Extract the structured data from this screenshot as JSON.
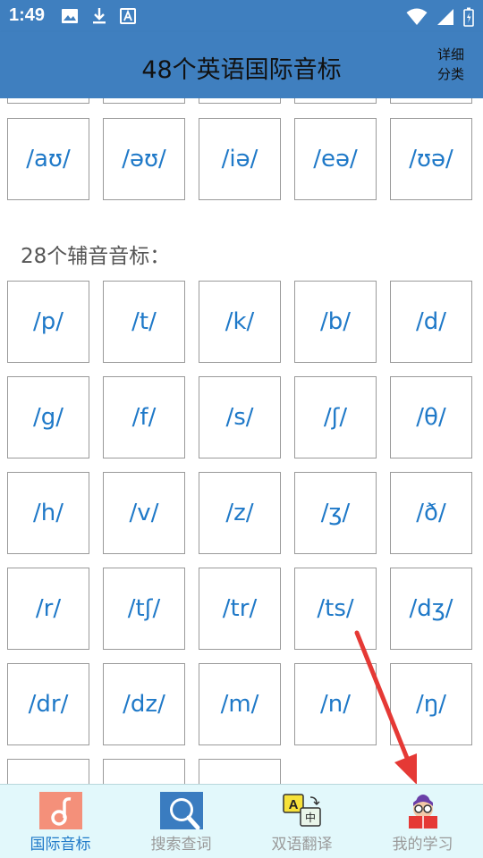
{
  "status_bar": {
    "time": "1:49"
  },
  "app_bar": {
    "title": "48个英语国际音标",
    "detail_line1": "详细",
    "detail_line2": "分类"
  },
  "vowels_tail": [
    "/aʊ/",
    "/əʊ/",
    "/iə/",
    "/eə/",
    "/ʊə/"
  ],
  "consonants": {
    "heading": "28个辅音音标：",
    "rows": [
      [
        "/p/",
        "/t/",
        "/k/",
        "/b/",
        "/d/"
      ],
      [
        "/g/",
        "/f/",
        "/s/",
        "/ʃ/",
        "/θ/"
      ],
      [
        "/h/",
        "/v/",
        "/z/",
        "/ʒ/",
        "/ð/"
      ],
      [
        "/r/",
        "/tʃ/",
        "/tr/",
        "/ts/",
        "/dʒ/"
      ],
      [
        "/dr/",
        "/dz/",
        "/m/",
        "/n/",
        "/ŋ/"
      ]
    ]
  },
  "bottom_nav": [
    {
      "label": "国际音标",
      "icon": "music-note-icon",
      "active": true
    },
    {
      "label": "搜索查词",
      "icon": "search-icon",
      "active": false
    },
    {
      "label": "双语翻译",
      "icon": "translate-icon",
      "active": false
    },
    {
      "label": "我的学习",
      "icon": "student-reading-icon",
      "active": false
    }
  ],
  "colors": {
    "primary": "#3f7fbf",
    "symbol_text": "#1f79c8",
    "nav_bg": "#e2f8fb",
    "arrow": "#e53935"
  }
}
